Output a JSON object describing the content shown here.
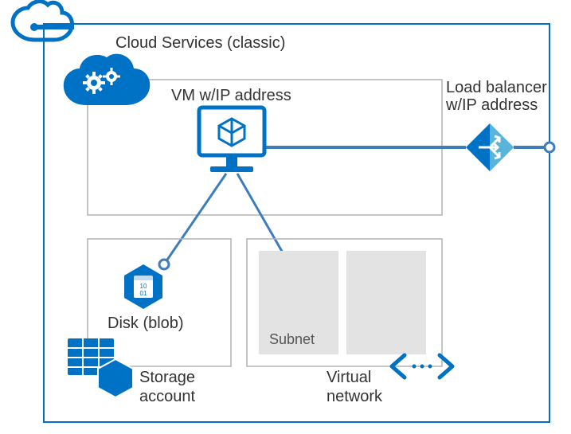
{
  "title": "Cloud Services (classic)",
  "vm_label_1": "VM w/IP address",
  "lb_label_1": "Load balancer",
  "lb_label_2": "w/IP address",
  "disk_label": "Disk (blob)",
  "storage_label_1": "Storage",
  "storage_label_2": "account",
  "subnet_label": "Subnet",
  "vnet_label_1": "Virtual",
  "vnet_label_2": "network",
  "colors": {
    "azure_blue": "#0072C6",
    "line_blue": "#3E7DBD",
    "fill_ltblue": "#59B4D9",
    "gray_border": "#B2B2B2",
    "subnet_fill": "#E3E3E3"
  }
}
